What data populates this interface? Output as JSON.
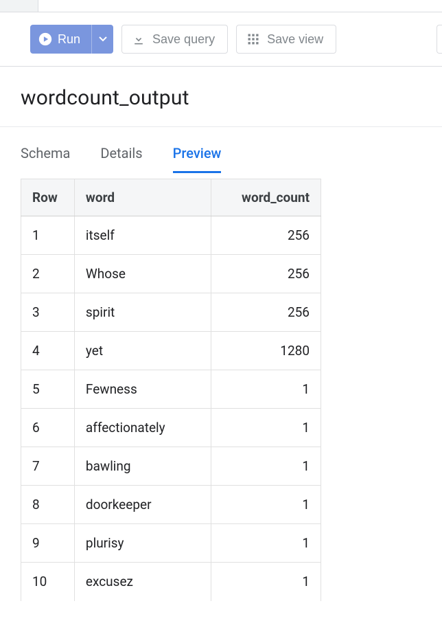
{
  "toolbar": {
    "run_label": "Run",
    "save_query_label": "Save query",
    "save_view_label": "Save view"
  },
  "title": "wordcount_output",
  "tabs": {
    "schema": "Schema",
    "details": "Details",
    "preview": "Preview",
    "active": "preview"
  },
  "table": {
    "headers": {
      "row": "Row",
      "word": "word",
      "word_count": "word_count"
    },
    "rows": [
      {
        "row": "1",
        "word": "itself",
        "word_count": "256"
      },
      {
        "row": "2",
        "word": "Whose",
        "word_count": "256"
      },
      {
        "row": "3",
        "word": "spirit",
        "word_count": "256"
      },
      {
        "row": "4",
        "word": "yet",
        "word_count": "1280"
      },
      {
        "row": "5",
        "word": "Fewness",
        "word_count": "1"
      },
      {
        "row": "6",
        "word": "affectionately",
        "word_count": "1"
      },
      {
        "row": "7",
        "word": "bawling",
        "word_count": "1"
      },
      {
        "row": "8",
        "word": "doorkeeper",
        "word_count": "1"
      },
      {
        "row": "9",
        "word": "plurisy",
        "word_count": "1"
      },
      {
        "row": "10",
        "word": "excusez",
        "word_count": "1"
      }
    ]
  }
}
